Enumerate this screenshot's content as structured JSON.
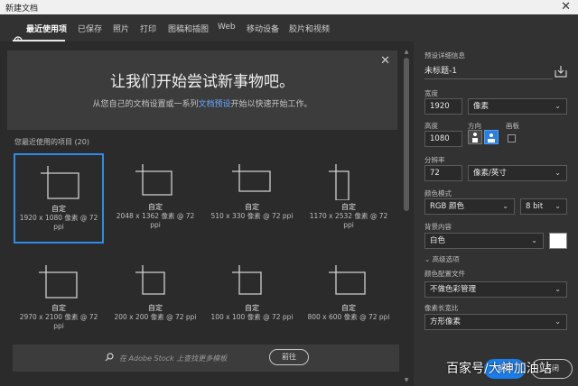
{
  "window": {
    "title": "新建文档",
    "close_glyph": "✕"
  },
  "tabs": [
    {
      "label": "最近使用项",
      "active": true,
      "icon": "clock-icon"
    },
    {
      "label": "已保存"
    },
    {
      "label": "照片"
    },
    {
      "label": "打印"
    },
    {
      "label": "图稿和插图"
    },
    {
      "label": "Web"
    },
    {
      "label": "移动设备"
    },
    {
      "label": "胶片和视频"
    }
  ],
  "welcome": {
    "heading": "让我们开始尝试新事物吧。",
    "sub_before": "从您自己的文档设置或一系列",
    "sub_link": "文档预设",
    "sub_after": "开始以快速开始工作。",
    "close_glyph": "✕"
  },
  "recent": {
    "label": "您最近使用的项目 (20)",
    "presets": [
      {
        "name": "自定",
        "dims": "1920 x 1080 像素 @ 72 ppi",
        "selected": true
      },
      {
        "name": "自定",
        "dims": "2048 x 1362 像素 @ 72 ppi"
      },
      {
        "name": "自定",
        "dims": "510 x 330 像素 @ 72 ppi"
      },
      {
        "name": "自定",
        "dims": "1170 x 2532 像素 @ 72 ppi"
      },
      {
        "name": "自定",
        "dims": "2970 x 2100 像素 @ 72 ppi"
      },
      {
        "name": "自定",
        "dims": "200 x 200 像素 @ 72 ppi"
      },
      {
        "name": "自定",
        "dims": "100 x 100 像素 @ 72 ppi"
      },
      {
        "name": "自定",
        "dims": "800 x 600 像素 @ 72 ppi"
      }
    ]
  },
  "stock": {
    "placeholder": "在 Adobe Stock 上查找更多模板",
    "go_label": "前往",
    "search_icon": "search-icon"
  },
  "details": {
    "header": "预设详细信息",
    "doc_title": "未标题-1",
    "width_label": "宽度",
    "width_value": "1920",
    "width_unit": "像素",
    "height_label": "高度",
    "height_value": "1080",
    "orientation_label": "方向",
    "artboard_label": "画板",
    "resolution_label": "分辨率",
    "resolution_value": "72",
    "resolution_unit": "像素/英寸",
    "color_mode_label": "颜色模式",
    "color_mode_value": "RGB 颜色",
    "bit_depth_value": "8 bit",
    "background_label": "背景内容",
    "background_value": "白色",
    "background_swatch": "#ffffff",
    "advanced_label": "高级选项",
    "profile_label": "颜色配置文件",
    "profile_value": "不做色彩管理",
    "pixel_ratio_label": "像素长宽比",
    "pixel_ratio_value": "方形像素",
    "create_label": "创建",
    "close_label": "关闭"
  },
  "watermark": "百家号/大神加油站",
  "colors": {
    "accent": "#2d8ceb",
    "create": "#1b7de8",
    "link": "#6aa8ff"
  }
}
